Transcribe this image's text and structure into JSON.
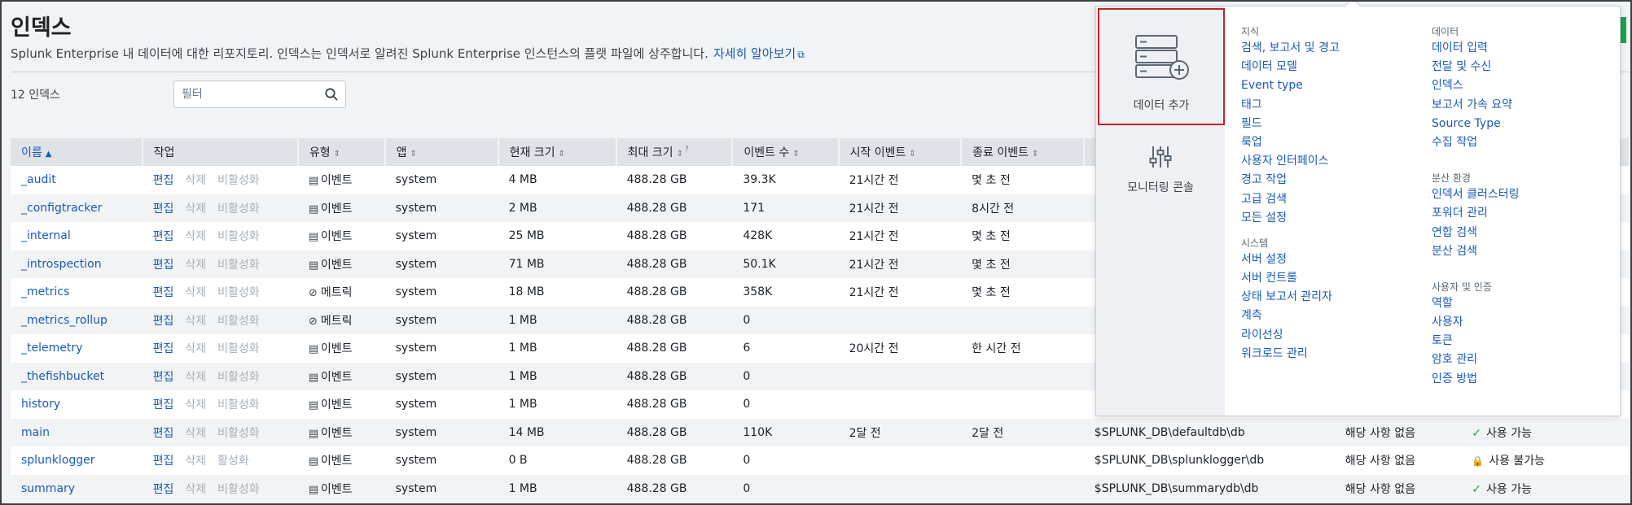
{
  "page": {
    "title": "인덱스",
    "description": "Splunk Enterprise 내 데이터에 대한 리포지토리. 인덱스는 인덱서로 알려진 Splunk Enterprise 인스턴스의 플랫 파일에 상주합니다.",
    "learn_more": "자세히 알아보기",
    "count_label": "12 인덱스",
    "filter_placeholder": "필터"
  },
  "colors": {
    "link": "#1a5ab8",
    "highlight_border": "#c6202b",
    "ok": "#1aa34a",
    "lock": "#d9343f"
  },
  "table": {
    "columns": [
      "이름",
      "작업",
      "유형",
      "앱",
      "현재 크기",
      "최대 크기",
      "이벤트 수",
      "시작 이벤트",
      "종료 이벤트",
      "",
      "",
      ""
    ],
    "rows": [
      {
        "name": "_audit",
        "edit": "편집",
        "delete": "삭제",
        "toggle": "비활성화",
        "type": "이벤트",
        "type_icon": "document-icon",
        "app": "system",
        "cur": "4 MB",
        "max": "488.28 GB",
        "events": "39.3K",
        "start": "21시간 전",
        "end": "몇 초 전",
        "path": "",
        "frozen": "",
        "status": "",
        "status_icon": ""
      },
      {
        "name": "_configtracker",
        "edit": "편집",
        "delete": "삭제",
        "toggle": "비활성화",
        "type": "이벤트",
        "type_icon": "document-icon",
        "app": "system",
        "cur": "2 MB",
        "max": "488.28 GB",
        "events": "171",
        "start": "21시간 전",
        "end": "8시간 전",
        "path": "",
        "frozen": "",
        "status": "",
        "status_icon": ""
      },
      {
        "name": "_internal",
        "edit": "편집",
        "delete": "삭제",
        "toggle": "비활성화",
        "type": "이벤트",
        "type_icon": "document-icon",
        "app": "system",
        "cur": "25 MB",
        "max": "488.28 GB",
        "events": "428K",
        "start": "21시간 전",
        "end": "몇 초 전",
        "path": "",
        "frozen": "",
        "status": "",
        "status_icon": ""
      },
      {
        "name": "_introspection",
        "edit": "편집",
        "delete": "삭제",
        "toggle": "비활성화",
        "type": "이벤트",
        "type_icon": "document-icon",
        "app": "system",
        "cur": "71 MB",
        "max": "488.28 GB",
        "events": "50.1K",
        "start": "21시간 전",
        "end": "몇 초 전",
        "path": "",
        "frozen": "",
        "status": "",
        "status_icon": ""
      },
      {
        "name": "_metrics",
        "edit": "편집",
        "delete": "삭제",
        "toggle": "비활성화",
        "type": "메트릭",
        "type_icon": "tag-icon",
        "app": "system",
        "cur": "18 MB",
        "max": "488.28 GB",
        "events": "358K",
        "start": "21시간 전",
        "end": "몇 초 전",
        "path": "",
        "frozen": "",
        "status": "",
        "status_icon": ""
      },
      {
        "name": "_metrics_rollup",
        "edit": "편집",
        "delete": "삭제",
        "toggle": "비활성화",
        "type": "메트릭",
        "type_icon": "tag-icon",
        "app": "system",
        "cur": "1 MB",
        "max": "488.28 GB",
        "events": "0",
        "start": "",
        "end": "",
        "path": "",
        "frozen": "",
        "status": "",
        "status_icon": ""
      },
      {
        "name": "_telemetry",
        "edit": "편집",
        "delete": "삭제",
        "toggle": "비활성화",
        "type": "이벤트",
        "type_icon": "document-icon",
        "app": "system",
        "cur": "1 MB",
        "max": "488.28 GB",
        "events": "6",
        "start": "20시간 전",
        "end": "한 시간 전",
        "path": "",
        "frozen": "",
        "status": "",
        "status_icon": ""
      },
      {
        "name": "_thefishbucket",
        "edit": "편집",
        "delete": "삭제",
        "toggle": "비활성화",
        "type": "이벤트",
        "type_icon": "document-icon",
        "app": "system",
        "cur": "1 MB",
        "max": "488.28 GB",
        "events": "0",
        "start": "",
        "end": "",
        "path": "",
        "frozen": "",
        "status": "",
        "status_icon": ""
      },
      {
        "name": "history",
        "edit": "편집",
        "delete": "삭제",
        "toggle": "비활성화",
        "type": "이벤트",
        "type_icon": "document-icon",
        "app": "system",
        "cur": "1 MB",
        "max": "488.28 GB",
        "events": "0",
        "start": "",
        "end": "",
        "path": "",
        "frozen": "",
        "status": "",
        "status_icon": ""
      },
      {
        "name": "main",
        "edit": "편집",
        "delete": "삭제",
        "toggle": "비활성화",
        "type": "이벤트",
        "type_icon": "document-icon",
        "app": "system",
        "cur": "14 MB",
        "max": "488.28 GB",
        "events": "110K",
        "start": "2달 전",
        "end": "2달 전",
        "path": "$SPLUNK_DB\\defaultdb\\db",
        "frozen": "해당 사항 없음",
        "status": "사용 가능",
        "status_icon": "check-icon"
      },
      {
        "name": "splunklogger",
        "edit": "편집",
        "delete": "삭제",
        "toggle": "활성화",
        "type": "이벤트",
        "type_icon": "document-icon",
        "app": "system",
        "cur": "0 B",
        "max": "488.28 GB",
        "events": "0",
        "start": "",
        "end": "",
        "path": "$SPLUNK_DB\\splunklogger\\db",
        "frozen": "해당 사항 없음",
        "status": "사용 불가능",
        "status_icon": "lock-icon"
      },
      {
        "name": "summary",
        "edit": "편집",
        "delete": "삭제",
        "toggle": "비활성화",
        "type": "이벤트",
        "type_icon": "document-icon",
        "app": "system",
        "cur": "1 MB",
        "max": "488.28 GB",
        "events": "0",
        "start": "",
        "end": "",
        "path": "$SPLUNK_DB\\summarydb\\db",
        "frozen": "해당 사항 없음",
        "status": "사용 가능",
        "status_icon": "check-icon"
      }
    ]
  },
  "menu": {
    "add_data": "데이터 추가",
    "monitoring_console": "모니터링 콘솔",
    "col1": [
      {
        "heading": "지식",
        "items": [
          "검색, 보고서 및 경고",
          "데이터 모델",
          "Event type",
          "태그",
          "필드",
          "룩업",
          "사용자 인터페이스",
          "경고 작업",
          "고급 검색",
          "모든 설정"
        ]
      },
      {
        "heading": "시스템",
        "items": [
          "서버 설정",
          "서버 컨트롤",
          "상태 보고서 관리자",
          "계측",
          "라이선싱",
          "워크로드 관리"
        ]
      }
    ],
    "col2": [
      {
        "heading": "데이터",
        "items": [
          "데이터 입력",
          "전달 및 수신",
          "인덱스",
          "보고서 가속 요약",
          "Source Type",
          "수집 작업"
        ]
      },
      {
        "heading": "분산 환경",
        "items": [
          "인덱서 클러스터링",
          "포워더 관리",
          "연합 검색",
          "분산 검색"
        ]
      },
      {
        "heading": "사용자 및 인증",
        "items": [
          "역할",
          "사용자",
          "토큰",
          "암호 관리",
          "인증 방법"
        ]
      }
    ]
  }
}
